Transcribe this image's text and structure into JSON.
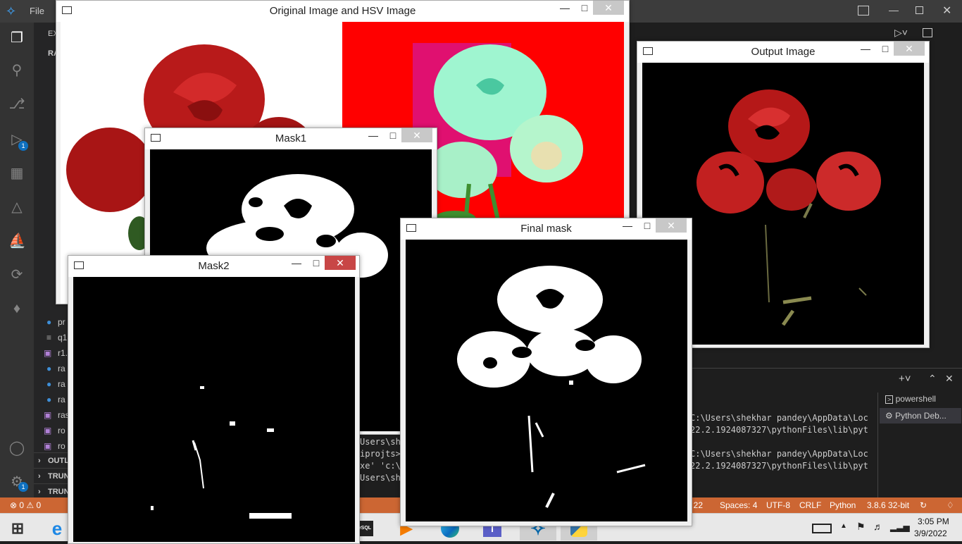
{
  "titlebar": {
    "menu_file": "File"
  },
  "sidebar": {
    "explorer_label": "EX",
    "root_label": "RA",
    "files": [
      "pr",
      "q1",
      "r1.",
      "ra",
      "ra",
      "ra",
      "ras",
      "ro",
      "ro"
    ],
    "sections": [
      "OUTL",
      "TRUN",
      "TRUN"
    ]
  },
  "terminal": {
    "lines_left": [
      "Users\\sh",
      "iprojts>",
      "xe' 'c:\\",
      "Users\\sh"
    ],
    "lines_right": [
      "C:\\Users\\shekhar pandey\\AppData\\Loc",
      "22.2.1924087327\\pythonFiles\\lib\\pyt",
      "",
      "C:\\Users\\shekhar pandey\\AppData\\Loc",
      "22.2.1924087327\\pythonFiles\\lib\\pyt"
    ],
    "panels": [
      "powershell",
      "Python Deb..."
    ]
  },
  "statusbar": {
    "problems": "0",
    "warnings": "0",
    "position": "ol 22",
    "spaces": "Spaces: 4",
    "encoding": "UTF-8",
    "eol": "CRLF",
    "language": "Python",
    "interpreter": "3.8.6 32-bit"
  },
  "taskbar": {
    "time": "3:05 PM",
    "date": "3/9/2022"
  },
  "windows": {
    "original": {
      "title": "Original Image and HSV Image"
    },
    "output": {
      "title": "Output Image"
    },
    "mask1": {
      "title": "Mask1"
    },
    "final": {
      "title": "Final mask"
    },
    "mask2": {
      "title": "Mask2"
    }
  },
  "colors": {
    "statusbar": "#cc6633",
    "rose_red": "#c41e1e",
    "hsv_red": "#ff0000",
    "hsv_cyan": "#9ff5d0"
  },
  "badges": {
    "debug": "1",
    "account": "1"
  }
}
